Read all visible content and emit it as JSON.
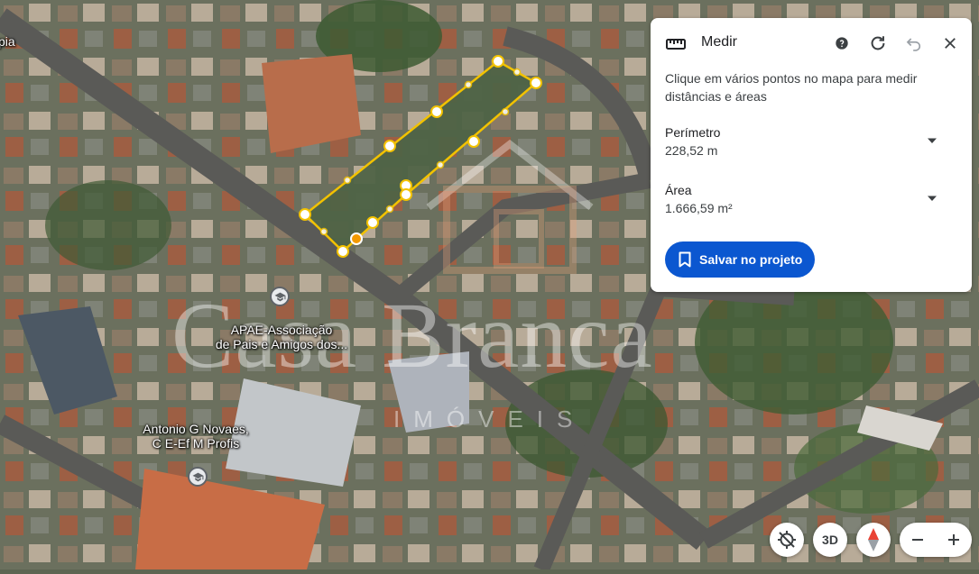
{
  "map": {
    "edge_label": "pia",
    "places": [
      {
        "name": "APAE-Associação\nde Pais e Amigos dos...",
        "icon": "school-icon"
      },
      {
        "name": "Antonio G Novaes,\nC E-Ef M Profis",
        "icon": "school-icon"
      }
    ],
    "watermark": {
      "title": "Casa Branca",
      "subtitle": "IMÓVEIS"
    },
    "measure_path_color": "#f2c200"
  },
  "panel": {
    "title": "Medir",
    "icon": "ruler-icon",
    "description": "Clique em vários pontos no mapa para medir distâncias e áreas",
    "perimeter": {
      "label": "Perímetro",
      "value": "228,52 m"
    },
    "area": {
      "label": "Área",
      "value": "1.666,59 m²"
    },
    "save_label": "Salvar no projeto",
    "header_icons": [
      "help-icon",
      "refresh-icon",
      "undo-icon",
      "close-icon"
    ],
    "accent": "#0b57d0"
  },
  "controls": {
    "three_d_label": "3D",
    "icons": [
      "location-off-icon",
      "compass-icon",
      "zoom-out-icon",
      "zoom-in-icon"
    ]
  }
}
